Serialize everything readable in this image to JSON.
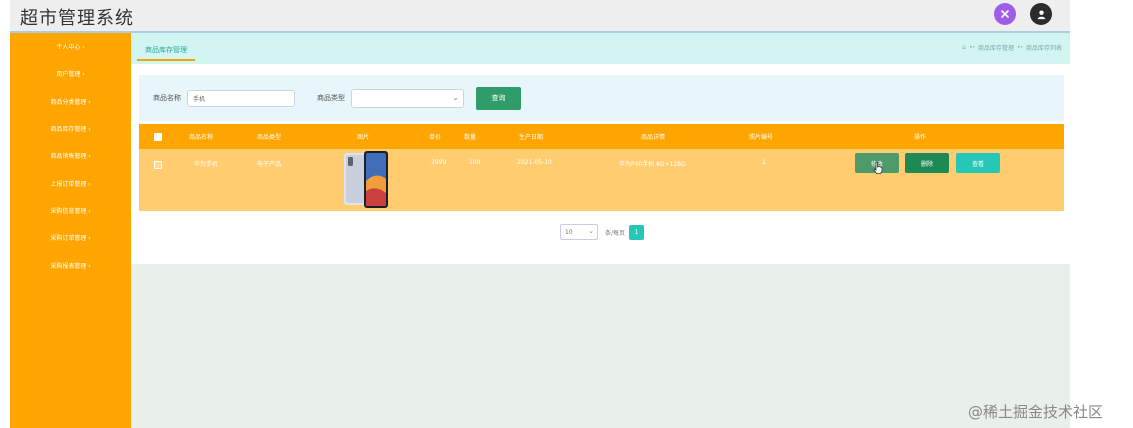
{
  "header": {
    "title": "超市管理系统"
  },
  "sidebar": {
    "items": [
      {
        "label": "个人中心 ›"
      },
      {
        "label": "用户管理 ›"
      },
      {
        "label": "商品分类管理 ›"
      },
      {
        "label": "商品库存管理 ›"
      },
      {
        "label": "商品销售管理 ›"
      },
      {
        "label": "上报订单管理 ›"
      },
      {
        "label": "采购信息管理 ›"
      },
      {
        "label": "采购订单管理 ›"
      },
      {
        "label": "采购报表管理 ›"
      }
    ]
  },
  "breadcrumb": {
    "active_tab": "商品库存管理",
    "home": "⌂",
    "path": [
      "商品库存管理",
      "商品库存列表"
    ],
    "sep": "•‹"
  },
  "search": {
    "name_label": "商品名称",
    "name_value": "手机",
    "category_label": "商品类型",
    "query_label": "查询"
  },
  "table": {
    "headers": [
      "商品名称",
      "商品类型",
      "图片",
      "单价",
      "数量",
      "生产日期",
      "商品详情",
      "照片编号",
      "操作"
    ],
    "rows": [
      {
        "name": "华为手机",
        "type": "电子产品",
        "price": "3999",
        "qty": "100",
        "date": "2021-05-10",
        "detail": "华为P40手机 8G+128G",
        "code": "1",
        "edit": "修改",
        "del": "删除",
        "view": "查看"
      }
    ]
  },
  "pagination": {
    "page_size": "10",
    "per_page_label": "条/每页",
    "current_page": "1"
  },
  "watermark": "@稀土掘金技术社区",
  "colors": {
    "sidebar": "#ffa500",
    "accent": "#27c7b8",
    "query_button": "#2e9d6a"
  }
}
